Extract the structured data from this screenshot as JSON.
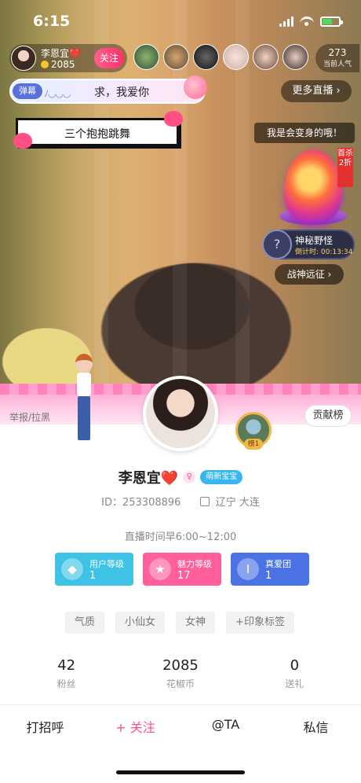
{
  "status_bar": {
    "time": "6:15"
  },
  "host": {
    "name": "李恩宜❤️",
    "coins": "2085",
    "follow_label": "关注"
  },
  "popularity": {
    "value": "273",
    "label": "当前人气"
  },
  "comment": {
    "tag": "弹幕",
    "deco": "ﾉ◡◡◡",
    "text": "求，我爱你"
  },
  "more_live": "更多直播 ›",
  "pixel_bubble": "三个抱抱跳舞",
  "right_badge": "我是会变身的哦！",
  "discount": "首杀2折",
  "mystery": {
    "title": "神秘野怪",
    "timer_label": "倒计时:",
    "timer": "00:13:34"
  },
  "expedition": "战神远征 ›",
  "profile": {
    "report": "举报/拉黑",
    "contrib_label": "贡献榜",
    "rank_label": "榜1",
    "name": "李恩宜❤️",
    "badge": "萌新宝宝",
    "id_text": "ID：253308896",
    "location": "辽宁 大连",
    "schedule": "直播时间早6:00~12:00",
    "levels": [
      {
        "title": "用户等级",
        "value": "1",
        "color": "#3ec3e6"
      },
      {
        "title": "魅力等级",
        "value": "17",
        "color": "#ff5f9a"
      },
      {
        "title": "真爱团",
        "value": "1",
        "color": "#4b73e6"
      }
    ],
    "tags": [
      "气质",
      "小仙女",
      "女神",
      "+印象标签"
    ],
    "stats": [
      {
        "value": "42",
        "label": "粉丝"
      },
      {
        "value": "2085",
        "label": "花椒币"
      },
      {
        "value": "0",
        "label": "送礼"
      }
    ],
    "actions": [
      "打招呼",
      "+ 关注",
      "@TA",
      "私信"
    ]
  }
}
